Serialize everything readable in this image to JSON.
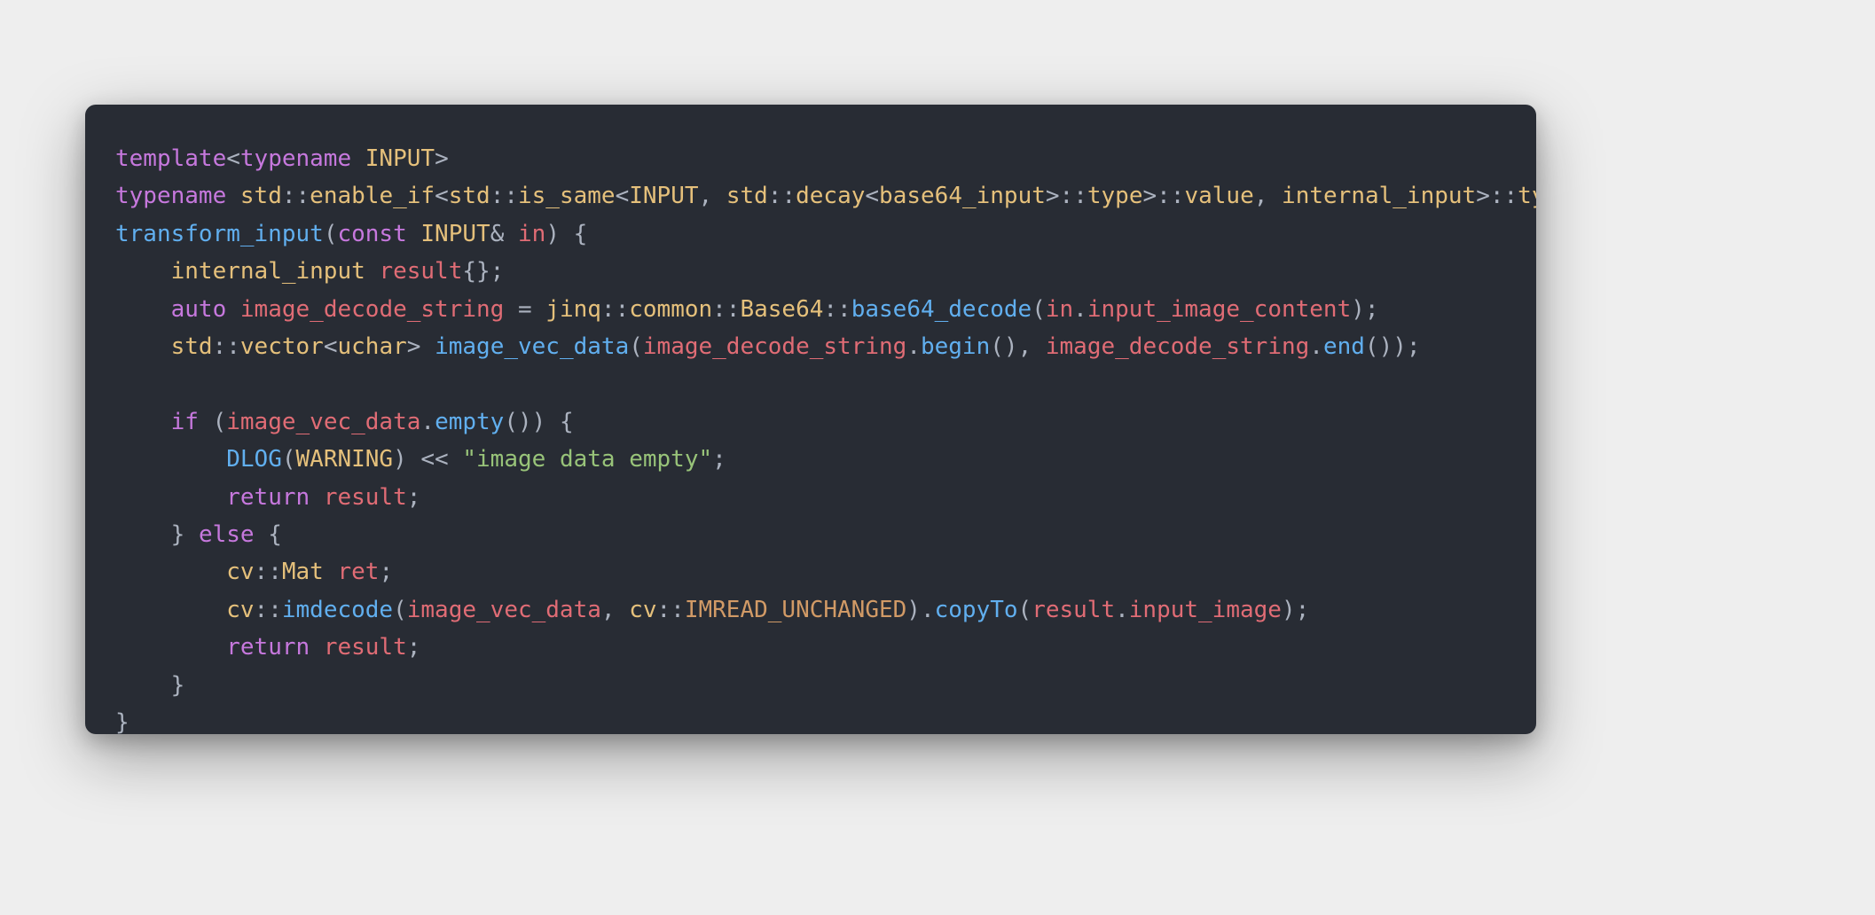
{
  "code": {
    "tokens": {
      "template": "template",
      "typename": "typename",
      "INPUT": "INPUT",
      "std": "std",
      "enable_if": "enable_if",
      "is_same": "is_same",
      "decay": "decay",
      "base64_input": "base64_input",
      "type": "type",
      "value": "value",
      "internal_input": "internal_input",
      "transform_input": "transform_input",
      "const": "const",
      "in": "in",
      "result": "result",
      "auto": "auto",
      "image_decode_string": "image_decode_string",
      "jinq": "jinq",
      "common": "common",
      "Base64": "Base64",
      "base64_decode": "base64_decode",
      "input_image_content": "input_image_content",
      "vector": "vector",
      "uchar": "uchar",
      "image_vec_data": "image_vec_data",
      "begin": "begin",
      "end": "end",
      "if": "if",
      "empty": "empty",
      "DLOG": "DLOG",
      "WARNING": "WARNING",
      "image_data_empty_str": "\"image data empty\"",
      "return": "return",
      "else": "else",
      "cv": "cv",
      "Mat": "Mat",
      "ret": "ret",
      "imdecode": "imdecode",
      "IMREAD_UNCHANGED": "IMREAD_UNCHANGED",
      "copyTo": "copyTo",
      "input_image": "input_image"
    },
    "punct": {
      "lt": "<",
      "gt": ">",
      "dcolon": "::",
      "comma_sp": ", ",
      "lparen": "(",
      "rparen": ")",
      "lbrace": "{",
      "rbrace": "}",
      "lbrace_rbrace": "{}",
      "semi": ";",
      "amp": "&",
      "space": " ",
      "eq": " = ",
      "dot": ".",
      "shift_sp": " << "
    }
  }
}
